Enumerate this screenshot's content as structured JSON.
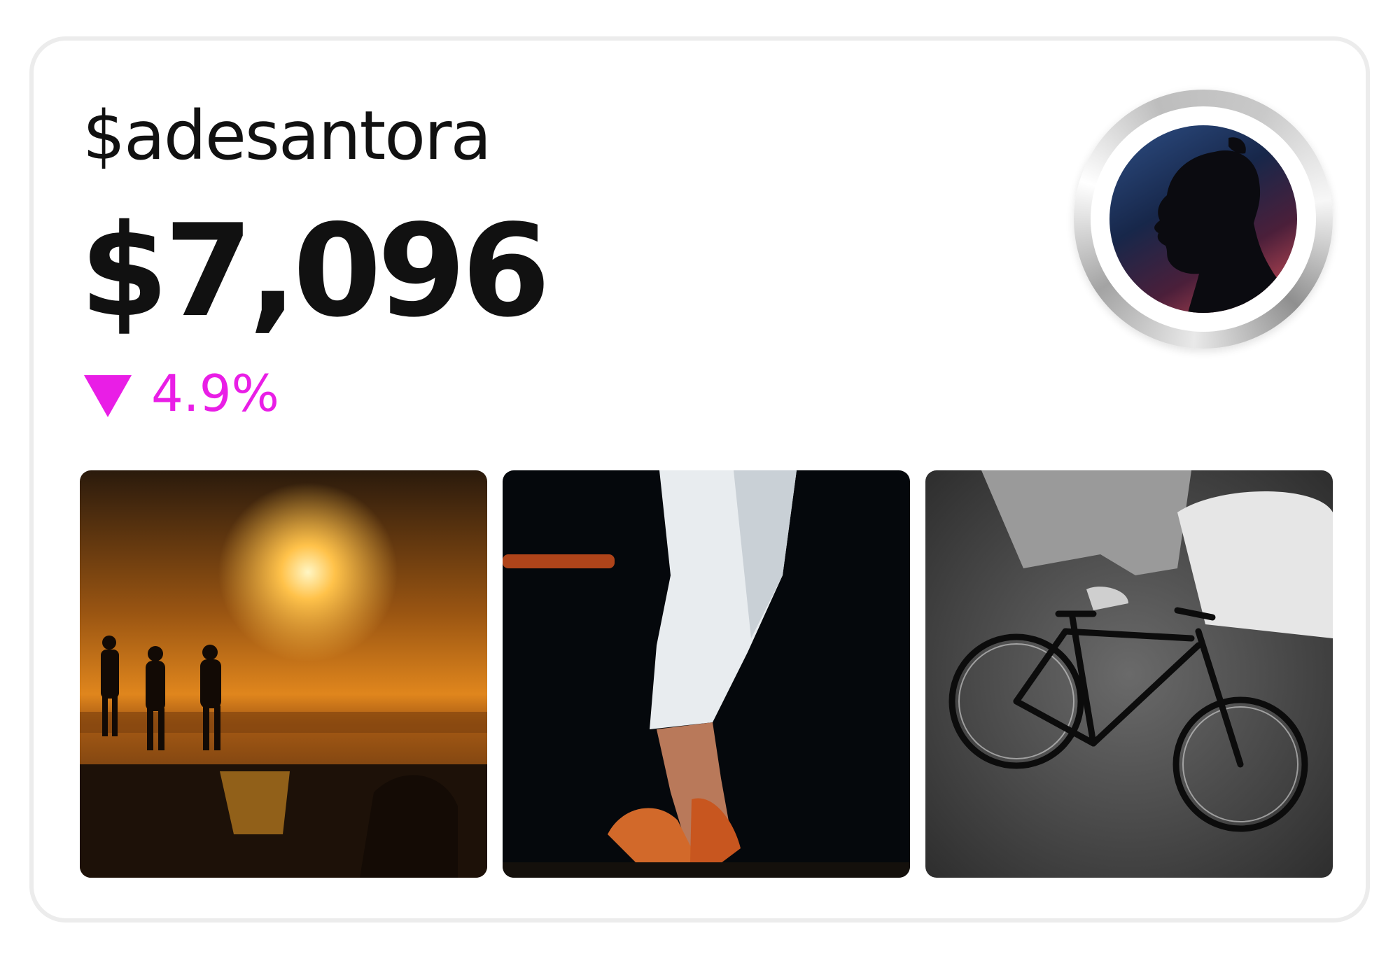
{
  "profile": {
    "handle": "$adesantora",
    "balance": "$7,096",
    "change": {
      "direction": "down",
      "value": "4.9%",
      "color": "#e91ee6"
    },
    "avatar_icon": "person-silhouette-avatar"
  },
  "gallery": [
    {
      "icon": "sunset-beach-photo"
    },
    {
      "icon": "high-heels-walking-photo"
    },
    {
      "icon": "bicycle-street-photo"
    }
  ]
}
